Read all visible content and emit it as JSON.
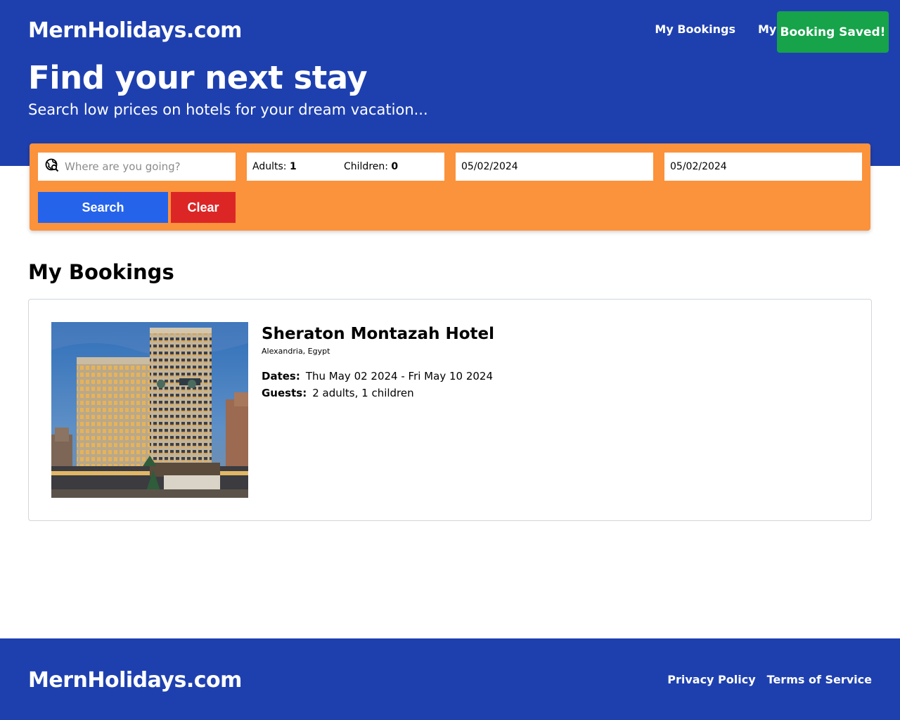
{
  "header": {
    "logo": "MernHolidays.com",
    "nav": {
      "my_bookings": "My Bookings",
      "my_hotels": "My Hotels"
    },
    "toast": "Booking Saved!",
    "title": "Find your next stay",
    "subtitle": "Search low prices on hotels for your dream vacation..."
  },
  "search": {
    "destination_placeholder": "Where are you going?",
    "adults_label": "Adults:",
    "adults_value": "1",
    "children_label": "Children:",
    "children_value": "0",
    "check_in": "05/02/2024",
    "check_out": "05/02/2024",
    "search_button": "Search",
    "clear_button": "Clear"
  },
  "bookings": {
    "title": "My Bookings",
    "items": [
      {
        "hotel_name": "Sheraton Montazah Hotel",
        "location": "Alexandria, Egypt",
        "dates_label": "Dates:",
        "dates_value": "Thu May 02 2024 - Fri May 10 2024",
        "guests_label": "Guests:",
        "guests_value": "2 adults, 1 children"
      }
    ]
  },
  "footer": {
    "logo": "MernHolidays.com",
    "privacy": "Privacy Policy",
    "terms": "Terms of Service"
  },
  "colors": {
    "primary": "#1e40af",
    "search_panel": "#fb923c",
    "search_button": "#2563eb",
    "clear_button": "#dc2626",
    "toast": "#16a34a"
  }
}
